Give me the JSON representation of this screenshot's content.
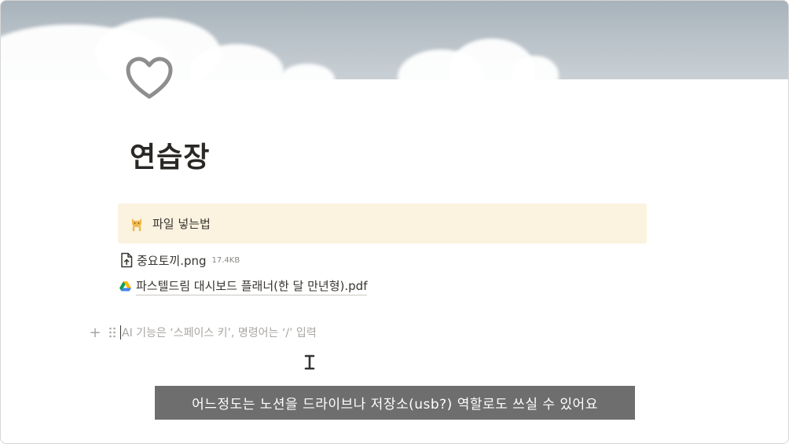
{
  "page": {
    "title": "연습장",
    "icon": "heart-outline-icon"
  },
  "callout": {
    "icon": "cat-emoji-icon",
    "text": "파일 넣는법",
    "background": "#fbf2e0"
  },
  "file": {
    "icon": "file-upload-icon",
    "name": "중요토끼.png",
    "size": "17.4KB"
  },
  "link": {
    "icon": "google-drive-icon",
    "name": "파스텔드림 대시보드 플래너(한 달 만년형).pdf"
  },
  "editor": {
    "add_icon": "+",
    "drag_handle_icon": "drag-handle-icon",
    "placeholder": "AI 기능은 ‘스페이스 키’, 명령어는 ‘/’ 입력"
  },
  "subtitle": {
    "text": "어느정도는 노션을 드라이브나 저장소(usb?) 역할로도 쓰실 수 있어요"
  }
}
